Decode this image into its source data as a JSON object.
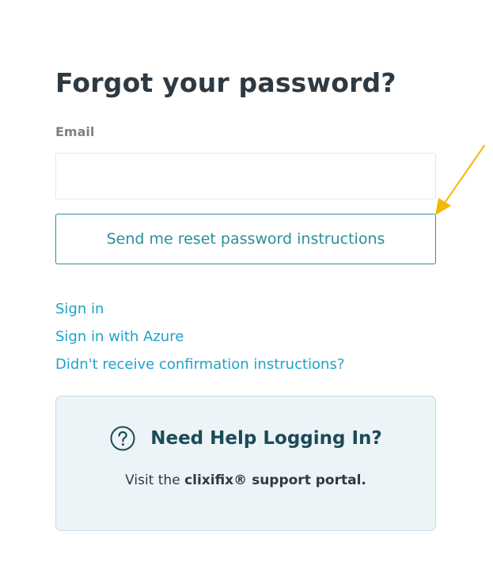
{
  "page_title": "Forgot your password?",
  "email_field": {
    "label": "Email",
    "value": "",
    "placeholder": ""
  },
  "reset_button_label": "Send me reset password instructions",
  "links": {
    "sign_in": "Sign in",
    "sign_in_azure": "Sign in with Azure",
    "confirmation": "Didn't receive confirmation instructions?"
  },
  "help": {
    "icon": "question-circle-icon",
    "title": "Need Help Logging In?",
    "text_prefix": "Visit the ",
    "portal_link": "clixifix® support portal."
  },
  "annotation": {
    "icon": "arrow-pointer-icon",
    "color": "#f5b800"
  },
  "colors": {
    "accent": "#2a8f9e",
    "link": "#1ea3c9",
    "title": "#2d3a44",
    "help_background": "#edf4f7",
    "help_title": "#1b4b57"
  }
}
